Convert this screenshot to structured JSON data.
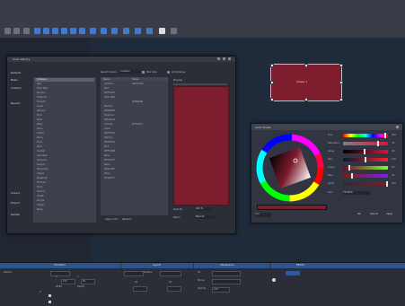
{
  "toolbar": {
    "icons": [
      "select-icon",
      "move-icon",
      "rotate-icon",
      "scale-icon",
      "grid-icon",
      "bounds-icon",
      "rect-tool-icon",
      "ellipse-tool-icon",
      "line-tool-icon",
      "text-tool-icon",
      "pan-icon",
      "zoom-icon",
      "color-icon",
      "settings-icon"
    ]
  },
  "library_dialog": {
    "title": "Color Library",
    "library_items": [
      "Default",
      "Basic",
      "Custom",
      "Recent"
    ],
    "bottom_items": [
      "Import",
      "Export",
      "Delete"
    ],
    "search_label": "Search Colors",
    "search_value": "Crimson",
    "option_1": "Hex Only",
    "option_2": "All Libraries",
    "list_items": [
      "Crimson",
      "Red",
      "Dark Red",
      "Maroon",
      "Firebrick",
      "Tomato",
      "Coral",
      "Salmon",
      "Pink",
      "Rose",
      "Ruby",
      "Wine",
      "Cherry",
      "Berry",
      "Brick",
      "Rust",
      "Scarlet",
      "Vermilion",
      "Cardinal",
      "Garnet",
      "Burgundy",
      "Claret",
      "Magenta",
      "Fuchsia",
      "Plum",
      "Orchid",
      "Violet",
      "Purple",
      "Indigo",
      "Navy"
    ],
    "group_header_1": "Name",
    "group_header_2": "Value",
    "group_items": [
      "Crimson",
      "#DC143C",
      "Red",
      "#FF0000",
      "Dark Red",
      "#8B0000",
      "Maroon",
      "#800000",
      "Firebrick",
      "#B22222",
      "Tomato",
      "#FF6347",
      "Coral",
      "#FF7F50",
      "Salmon",
      "#FA8072",
      "Pink",
      "#FFC0CB",
      "Rose",
      "#FF007F",
      "Ruby",
      "#E0115F",
      "Wine",
      "#722F37"
    ],
    "group_side_1": "Hex Color",
    "group_side_2": "Display Name",
    "preview_header": "Preview",
    "footer_left": "Apply Color",
    "footer_mid": "Replace",
    "footer_r1": "Opacity",
    "footer_r1_val": "100 %",
    "footer_r2": "Blend",
    "footer_r2_val": "Normal"
  },
  "canvas_shape": {
    "label": "Shape 1"
  },
  "color_panel": {
    "title": "Color Picker",
    "sliders": [
      {
        "label": "Hue",
        "value": "352"
      },
      {
        "label": "Saturation",
        "value": "78"
      },
      {
        "label": "Value",
        "value": "49"
      },
      {
        "label": "Red",
        "value": "126"
      },
      {
        "label": "Green",
        "value": "29"
      },
      {
        "label": "Blue",
        "value": "45"
      },
      {
        "label": "Alpha",
        "value": "255"
      },
      {
        "label": "Hex",
        "value": "7E1D2D"
      }
    ],
    "hex_label": "Hex",
    "ok_label": "OK",
    "cancel_label": "Cancel",
    "apply_label": "Apply"
  },
  "bottom_panel": {
    "tabs": [
      "Transform",
      "Layout",
      "Appearance",
      "Effects"
    ],
    "fields": [
      "Position",
      "X",
      "Y",
      "Width",
      "Height",
      "Rotation",
      "Fill",
      "Stroke",
      "Opacity"
    ],
    "values": [
      "120",
      "80",
      "64",
      "32",
      "0",
      "100"
    ]
  },
  "colors": {
    "accent": "#2e548e",
    "swatch": "#7e1d2d",
    "dialog_bg": "#2b2e36"
  }
}
